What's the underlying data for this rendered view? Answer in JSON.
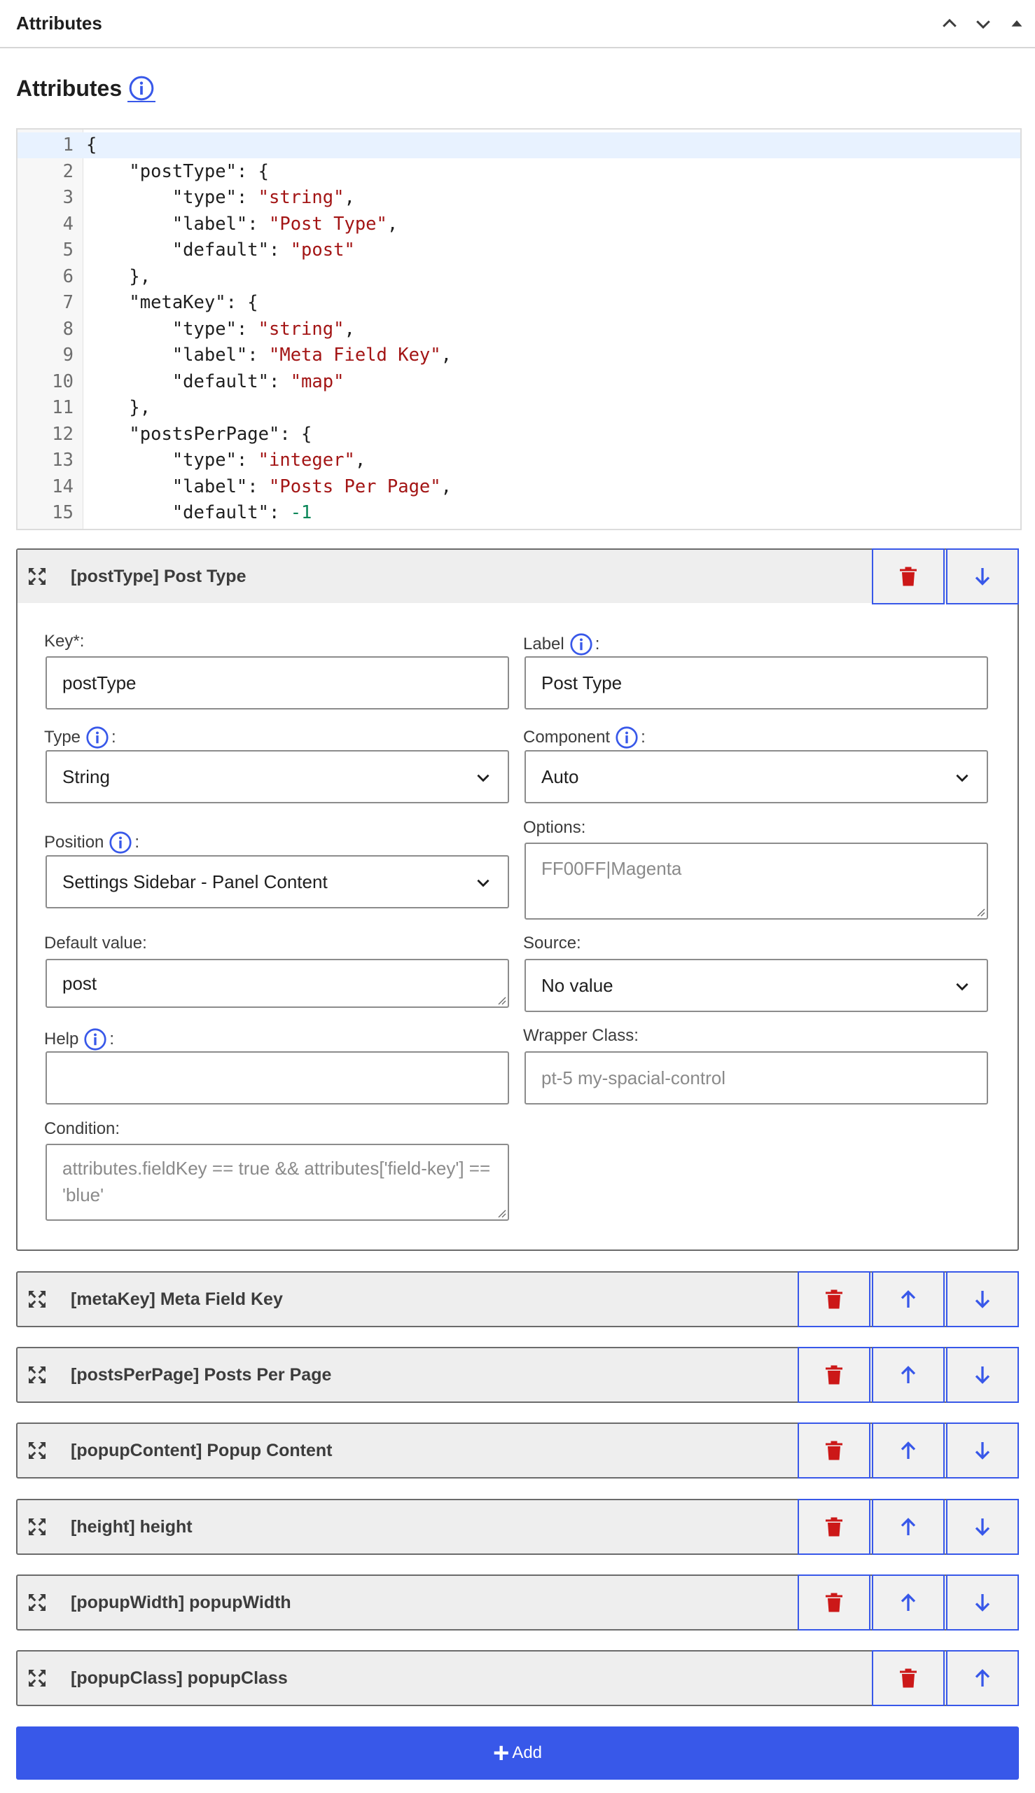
{
  "panel": {
    "title": "Attributes"
  },
  "section": {
    "title": "Attributes"
  },
  "code_lines": [
    [
      "1",
      "{"
    ],
    [
      "2",
      "    \"postType\": {"
    ],
    [
      "3",
      "        \"type\": \"string\","
    ],
    [
      "4",
      "        \"label\": \"Post Type\","
    ],
    [
      "5",
      "        \"default\": \"post\""
    ],
    [
      "6",
      "    },"
    ],
    [
      "7",
      "    \"metaKey\": {"
    ],
    [
      "8",
      "        \"type\": \"string\","
    ],
    [
      "9",
      "        \"label\": \"Meta Field Key\","
    ],
    [
      "10",
      "        \"default\": \"map\""
    ],
    [
      "11",
      "    },"
    ],
    [
      "12",
      "    \"postsPerPage\": {"
    ],
    [
      "13",
      "        \"type\": \"integer\","
    ],
    [
      "14",
      "        \"label\": \"Posts Per Page\","
    ],
    [
      "15",
      "        \"default\": -1"
    ]
  ],
  "expanded": {
    "title": "[postType] Post Type",
    "key_label": "Key*:",
    "key_value": "postType",
    "label_label": "Label",
    "label_value": "Post Type",
    "type_label": "Type",
    "type_value": "String",
    "component_label": "Component",
    "component_value": "Auto",
    "position_label": "Position",
    "position_value": "Settings Sidebar - Panel Content",
    "options_label": "Options:",
    "options_placeholder": "FF00FF|Magenta",
    "default_label": "Default value:",
    "default_value": "post",
    "source_label": "Source:",
    "source_value": "No value",
    "help_label": "Help",
    "help_value": "",
    "wrapper_label": "Wrapper Class:",
    "wrapper_placeholder": "pt-5 my-spacial-control",
    "condition_label": "Condition:",
    "condition_placeholder": "attributes.fieldKey == true && attributes['field-key'] == 'blue'"
  },
  "rows": [
    {
      "title": "[metaKey] Meta Field Key"
    },
    {
      "title": "[postsPerPage] Posts Per Page"
    },
    {
      "title": "[popupContent] Popup Content"
    },
    {
      "title": "[height] height"
    },
    {
      "title": "[popupWidth] popupWidth"
    },
    {
      "title": "[popupClass] popupClass"
    }
  ],
  "add_button": {
    "label": "Add"
  },
  "colors": {
    "accent": "#3858e9",
    "danger": "#cc1818",
    "row_bg": "#eeeeee"
  },
  "icons": [
    "chevron-up-icon",
    "chevron-down-icon",
    "triangle-up-icon",
    "info-icon",
    "drag-icon",
    "trash-icon",
    "arrow-up-icon",
    "arrow-down-icon",
    "plus-icon"
  ]
}
